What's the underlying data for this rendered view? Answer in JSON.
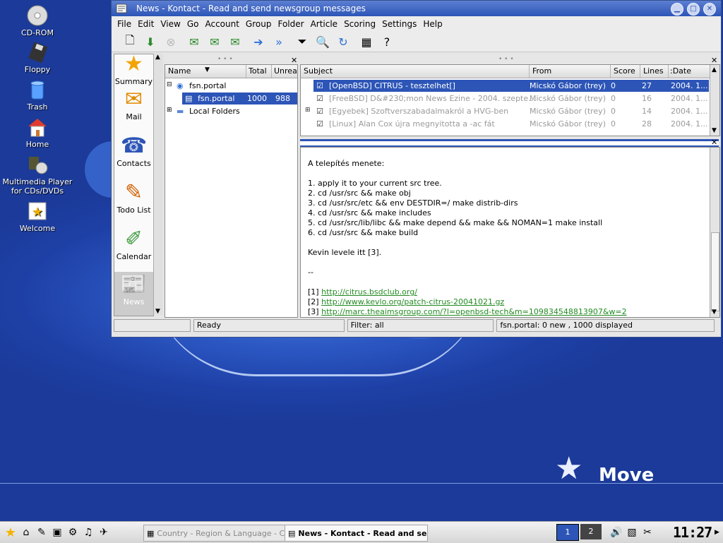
{
  "desktop": {
    "icons": [
      {
        "label": "CD-ROM",
        "icon": "cdrom-icon"
      },
      {
        "label": "Floppy",
        "icon": "floppy-icon"
      },
      {
        "label": "Trash",
        "icon": "trash-icon"
      },
      {
        "label": "Home",
        "icon": "home-icon"
      },
      {
        "label": "Multimedia Player for CDs/DVDs",
        "icon": "multimedia-icon"
      },
      {
        "label": "Welcome",
        "icon": "welcome-icon"
      }
    ],
    "brand": "Move"
  },
  "window": {
    "title": "News - Kontact - Read and send newsgroup messages"
  },
  "menu": [
    "File",
    "Edit",
    "View",
    "Go",
    "Account",
    "Group",
    "Folder",
    "Article",
    "Scoring",
    "Settings",
    "Help"
  ],
  "sidebar": {
    "items": [
      "Summary",
      "Mail",
      "Contacts",
      "Todo List",
      "Calendar",
      "News"
    ]
  },
  "folders": {
    "headers": {
      "name": "Name",
      "total": "Total",
      "unread": "Unrea"
    },
    "rows": [
      {
        "name": "fsn.portal",
        "total": "",
        "unread": ""
      },
      {
        "name": "fsn.portal",
        "total": "1000",
        "unread": "988"
      },
      {
        "name": "Local Folders",
        "total": "",
        "unread": ""
      }
    ]
  },
  "messages": {
    "headers": {
      "subject": "Subject",
      "from": "From",
      "score": "Score",
      "lines": "Lines",
      "date": ":Date"
    },
    "rows": [
      {
        "subject": "[OpenBSD] CITRUS - tesztelhet[]",
        "from": "Micskó Gábor (trey)",
        "score": "0",
        "lines": "27",
        "date": "2004. 1..."
      },
      {
        "subject": "[FreeBSD] D&#230;mon News Ezine - 2004. szepte...",
        "from": "Micskó Gábor (trey)",
        "score": "0",
        "lines": "16",
        "date": "2004. 1..."
      },
      {
        "subject": "[Egyebek] Szoftverszabadalmakról a HVG-ben",
        "from": "Micskó Gábor (trey)",
        "score": "0",
        "lines": "14",
        "date": "2004. 1..."
      },
      {
        "subject": "[Linux] Alan Cox újra megnyitotta a -ac fát",
        "from": "Micskó Gábor (trey)",
        "score": "0",
        "lines": "28",
        "date": "2004. 1..."
      }
    ]
  },
  "article": {
    "lines": [
      "A telepítés menete:",
      "",
      "1. apply it to your current src tree.",
      "2. cd /usr/src && make obj",
      "3. cd /usr/src/etc && env DESTDIR=/ make distrib-dirs",
      "4. cd /usr/src && make includes",
      "5. cd /usr/src/lib/libc && make depend && make && NOMAN=1 make install",
      "6. cd /usr/src && make build",
      "",
      "Kevin levele itt [3].",
      "",
      "--",
      ""
    ],
    "refs": [
      {
        "num": "[1]",
        "url": "http://citrus.bsdclub.org/"
      },
      {
        "num": "[2]",
        "url": "http://www.kevlo.org/patch-citrus-20041021.gz"
      },
      {
        "num": "[3]",
        "url": "http://marc.theaimsgroup.com/?l=openbsd-tech&m=109834548813907&w=2"
      }
    ]
  },
  "status": {
    "empty": "",
    "ready": "Ready",
    "filter": "Filter: all",
    "summary": "fsn.portal: 0 new , 1000 displayed"
  },
  "taskbar": {
    "tasks": [
      {
        "label": "Country - Region & Language - C",
        "active": false
      },
      {
        "label": "News - Kontact - Read and send",
        "active": true
      }
    ],
    "desktops": [
      "1",
      "2"
    ],
    "clock": "11:27"
  }
}
